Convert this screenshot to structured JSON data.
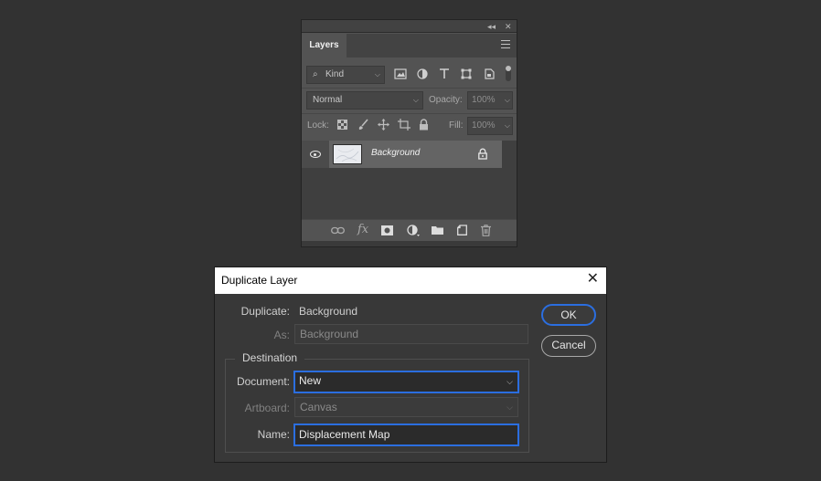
{
  "layers_panel": {
    "tab_title": "Layers",
    "collapse_glyph": "◂◂",
    "close_glyph": "✕",
    "filter": {
      "kind_label": "Kind"
    },
    "blend_mode": "Normal",
    "opacity_label": "Opacity:",
    "opacity_value": "100%",
    "lock_label": "Lock:",
    "fill_label": "Fill:",
    "fill_value": "100%",
    "layer": {
      "name": "Background",
      "thumb_color": "#e9ebef"
    },
    "bottom_icons": [
      "link-layers-icon",
      "fx-icon",
      "add-mask-icon",
      "adjustment-layer-icon",
      "new-group-icon",
      "new-layer-icon",
      "delete-icon"
    ],
    "fx_label": "fx"
  },
  "dialog": {
    "title": "Duplicate Layer",
    "duplicate_label": "Duplicate:",
    "duplicate_value": "Background",
    "as_label": "As:",
    "as_value": "Background",
    "destination_label": "Destination",
    "document_label": "Document:",
    "document_value": "New",
    "artboard_label": "Artboard:",
    "artboard_value": "Canvas",
    "name_label": "Name:",
    "name_value": "Displacement Map",
    "ok_label": "OK",
    "cancel_label": "Cancel"
  },
  "colors": {
    "background": "#323232",
    "panel": "#535353",
    "dialog": "#383838",
    "focus_accent": "#2b6ee0",
    "selected_layer": "#646464"
  }
}
